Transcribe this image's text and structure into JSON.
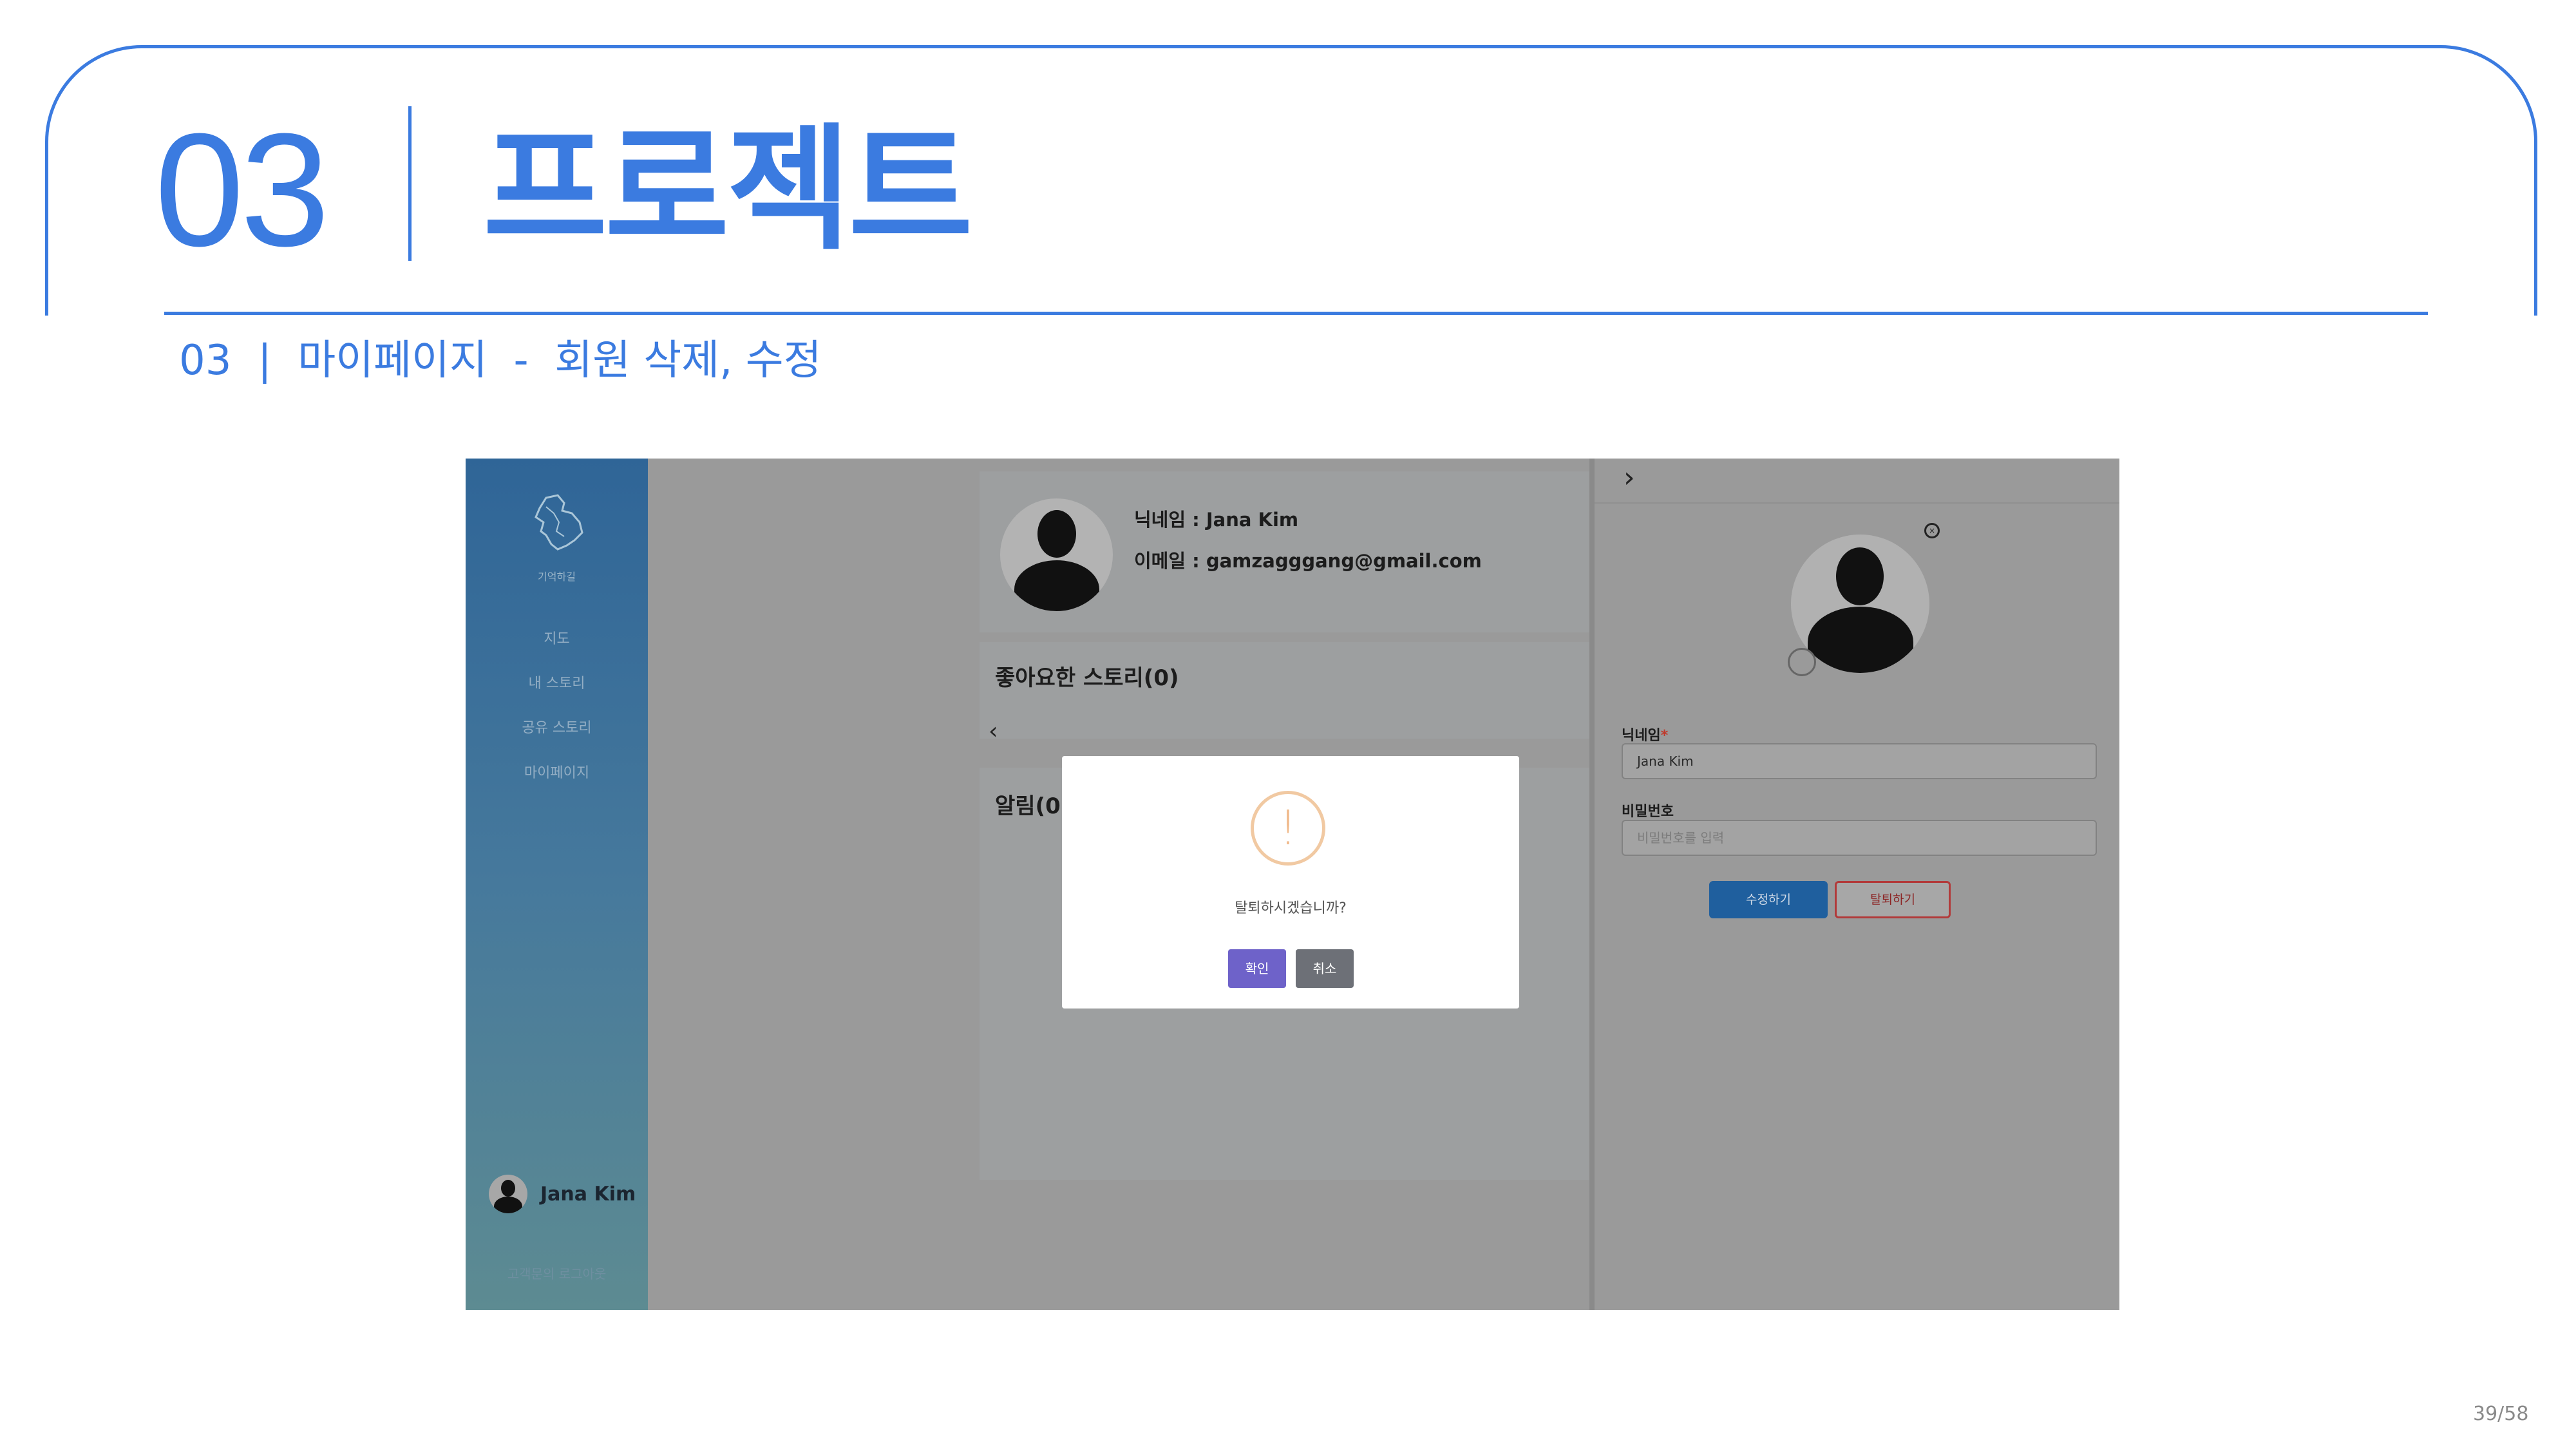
{
  "slide": {
    "section_number": "03",
    "section_title": "프로젝트",
    "subtitle": "03  |  마이페이지  -  회원 삭제, 수정",
    "page": "39/58",
    "accent_color": "#3b7be0"
  },
  "app": {
    "sidebar": {
      "logo_icon": "korea-map-logo-icon",
      "logo_text": "기억하길",
      "nav": [
        "지도",
        "내 스토리",
        "공유 스토리",
        "마이페이지"
      ],
      "user_name": "Jana Kim",
      "footer": "고객문의  로그아웃"
    },
    "profile": {
      "nickname_line": "닉네임 : Jana Kim",
      "email_line": "이메일 : gamzagggang@gmail.com"
    },
    "liked_stories_title": "좋아요한 스토리(0)",
    "alerts_title": "알림(0)",
    "edit_panel": {
      "nickname_label": "닉네임",
      "required_mark": "*",
      "nickname_value": "Jana Kim",
      "password_label": "비밀번호",
      "password_placeholder": "비밀번호를 입력",
      "edit_button": "수정하기",
      "withdraw_button": "탈퇴하기"
    },
    "modal": {
      "icon": "warning-icon",
      "message": "탈퇴하시겠습니까?",
      "confirm": "확인",
      "cancel": "취소"
    }
  }
}
